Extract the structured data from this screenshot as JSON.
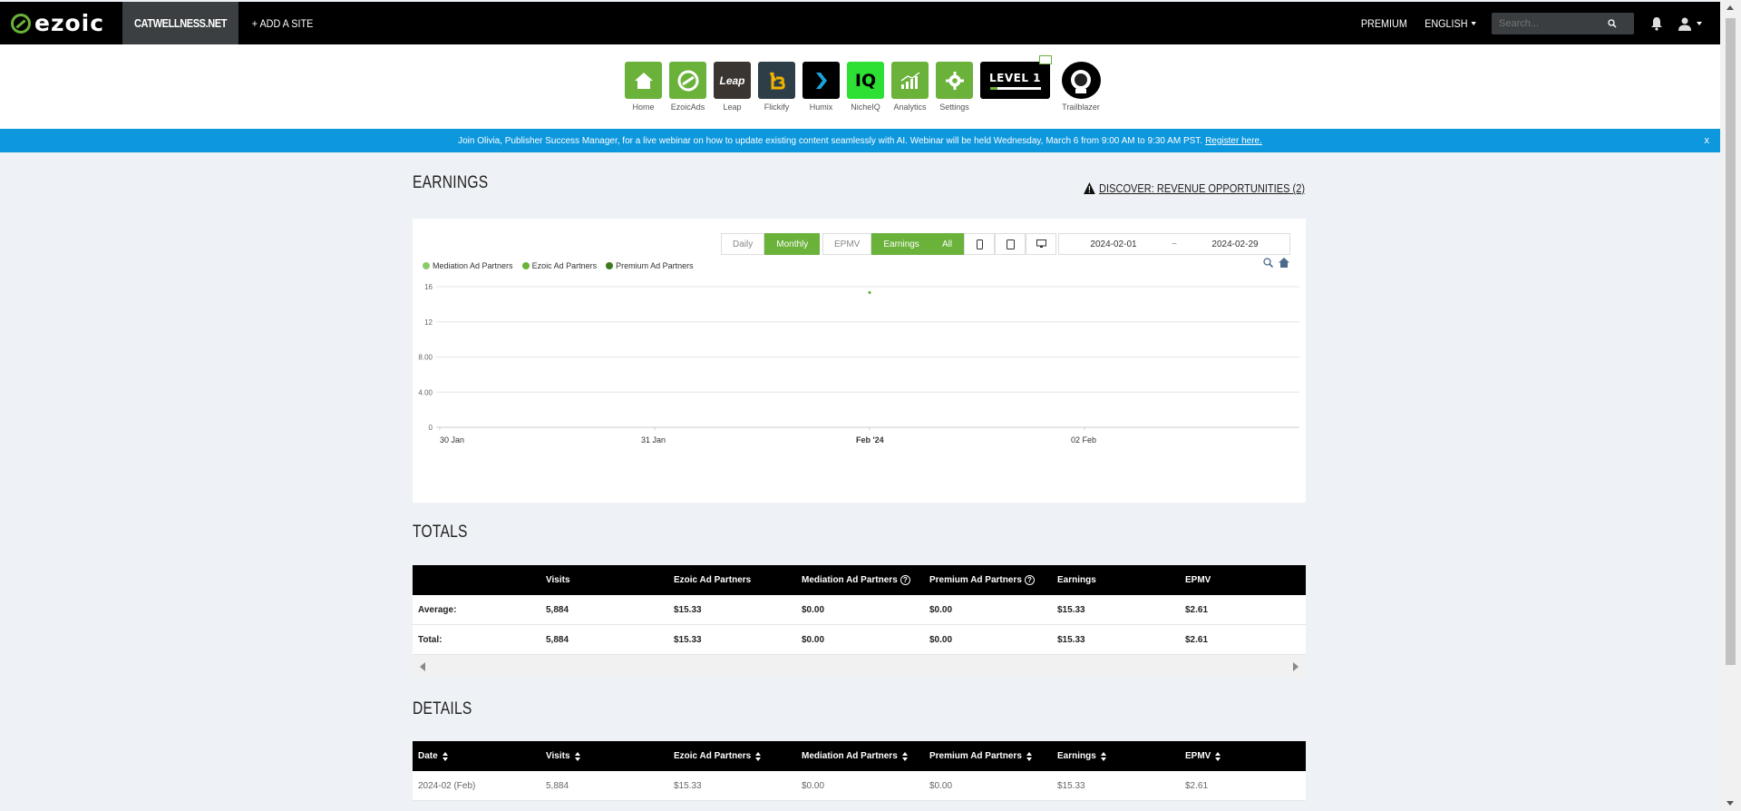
{
  "topnav": {
    "logo_text": "ezoic",
    "site_name": "CATWELLNESS.NET",
    "add_site": "+ ADD A SITE",
    "premium": "PREMIUM",
    "language": "ENGLISH",
    "search_placeholder": "Search..."
  },
  "apps": [
    {
      "label": "Home",
      "color": "#6ab23a"
    },
    {
      "label": "EzoicAds",
      "color": "#6ab23a"
    },
    {
      "label": "Leap",
      "color": "#3a3531"
    },
    {
      "label": "Flickify",
      "color": "#2e3e48"
    },
    {
      "label": "Humix",
      "color": "#000000"
    },
    {
      "label": "NicheIQ",
      "color": "#2ee033"
    },
    {
      "label": "Analytics",
      "color": "#6ab23a"
    },
    {
      "label": "Settings",
      "color": "#6ab23a"
    }
  ],
  "leap_tile_text": "Leap",
  "nicheiq_tile_text": "IQ",
  "level_badge": "LEVEL 1",
  "trailblazer_label": "Trailblazer",
  "announcement": {
    "text": "Join Olivia, Publisher Success Manager, for a live webinar on how to update existing content seamlessly with AI. Webinar will be held Wednesday, March 6 from 9:00 AM to 9:30 AM PST.",
    "link": "Register here.",
    "close": "x"
  },
  "earnings": {
    "title": "EARNINGS",
    "discover": "DISCOVER: REVENUE OPPORTUNITIES (2)",
    "period_buttons": [
      "Daily",
      "Monthly"
    ],
    "metric_buttons": [
      "EPMV",
      "Earnings"
    ],
    "device_all": "All",
    "date_start": "2024-02-01",
    "date_sep": "~",
    "date_end": "2024-02-29"
  },
  "chart_data": {
    "type": "scatter",
    "legend": [
      {
        "name": "Mediation Ad Partners",
        "color": "#8cc96a"
      },
      {
        "name": "Ezoic Ad Partners",
        "color": "#6ab23a"
      },
      {
        "name": "Premium Ad Partners",
        "color": "#3d7a1c"
      }
    ],
    "y_ticks": [
      "0",
      "4.00",
      "8.00",
      "12",
      "16"
    ],
    "ylim": [
      0,
      16
    ],
    "x_ticks": [
      "30 Jan",
      "31 Jan",
      "Feb '24",
      "02 Feb"
    ],
    "series": [
      {
        "name": "Ezoic Ad Partners",
        "points": [
          {
            "x": "Feb '24",
            "y": 15.33
          }
        ]
      }
    ],
    "grid": true
  },
  "totals": {
    "title": "TOTALS",
    "headers": [
      "",
      "Visits",
      "Ezoic Ad Partners",
      "Mediation Ad Partners",
      "Premium Ad Partners",
      "Earnings",
      "EPMV"
    ],
    "rows": [
      [
        "Average:",
        "5,884",
        "$15.33",
        "$0.00",
        "$0.00",
        "$15.33",
        "$2.61"
      ],
      [
        "Total:",
        "5,884",
        "$15.33",
        "$0.00",
        "$0.00",
        "$15.33",
        "$2.61"
      ]
    ]
  },
  "details": {
    "title": "DETAILS",
    "headers": [
      "Date",
      "Visits",
      "Ezoic Ad Partners",
      "Mediation Ad Partners",
      "Premium Ad Partners",
      "Earnings",
      "EPMV"
    ],
    "rows": [
      [
        "2024-02 (Feb)",
        "5,884",
        "$15.33",
        "$0.00",
        "$0.00",
        "$15.33",
        "$2.61"
      ]
    ]
  }
}
